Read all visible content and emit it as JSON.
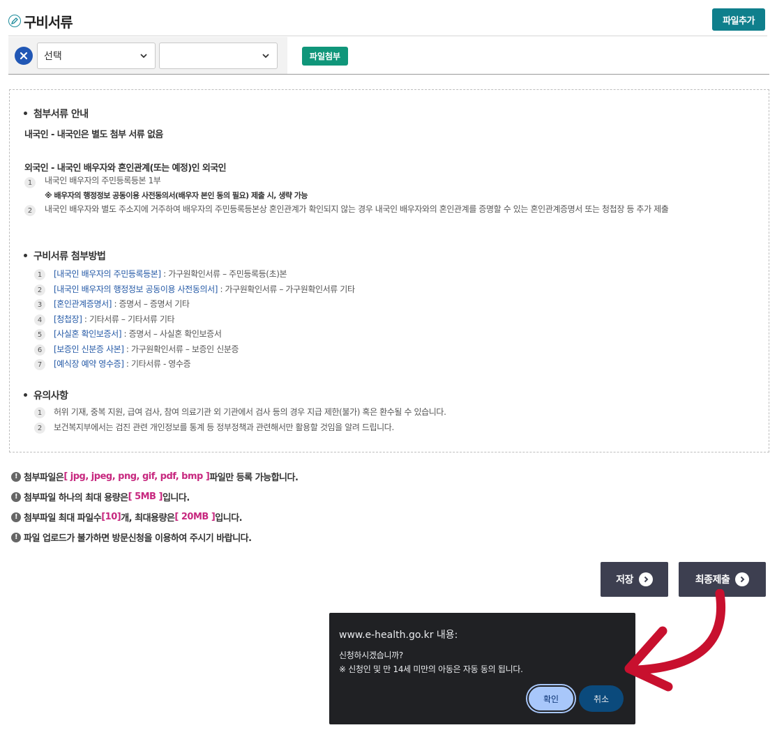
{
  "header": {
    "title": "구비서류",
    "add_file_label": "파일추가"
  },
  "file_row": {
    "select1_value": "선택",
    "select2_value": "",
    "attach_label": "파일첨부"
  },
  "info": {
    "guide": {
      "title": "첨부서류 안내",
      "domestic": "내국인 - 내국인은 별도 첨부 서류 없음",
      "foreign": "외국인 - 내국인 배우자와 혼인관계(또는 예정)인 외국인",
      "items": [
        {
          "num": "1",
          "text": "내국인 배우자의 주민등록등본 1부"
        },
        {
          "num": "2",
          "text": "내국인 배우자와 별도 주소지에 거주하여 배우자의 주민등록등본상 혼인관계가 확인되지 않는 경우 내국인 배우자와의 혼인관계를 증명할 수 있는 혼인관계증명서 또는 청첩장 등 추가 제출"
        }
      ],
      "note": "※ 배우자의 행정정보 공동이용 사전동의서(배우자 본인 동의 필요) 제출 시, 생략 가능"
    },
    "method": {
      "title": "구비서류 첨부방법",
      "items": [
        {
          "num": "1",
          "link": "[내국인 배우자의 주민등록등본]",
          "text": " : 가구원확인서류 – 주민등록등(초)본"
        },
        {
          "num": "2",
          "link": "[내국인 배우자의 행정정보 공동이용 사전동의서]",
          "text": " : 가구원확인서류 – 가구원확인서류 기타"
        },
        {
          "num": "3",
          "link": "[혼인관계증명서]",
          "text": " : 증명서 – 증명서 기타"
        },
        {
          "num": "4",
          "link": "[청첩장]",
          "text": " : 기타서류 – 기타서류 기타"
        },
        {
          "num": "5",
          "link": "[사실혼 확인보증서]",
          "text": " : 증명서 – 사실혼 확인보증서"
        },
        {
          "num": "6",
          "link": "[보증인 신분증 사본]",
          "text": " : 가구원확인서류 – 보증인 신분증"
        },
        {
          "num": "7",
          "link": "[예식장 예약 영수증]",
          "text": " : 기타서류 - 영수증"
        }
      ]
    },
    "caution": {
      "title": "유의사항",
      "items": [
        {
          "num": "1",
          "text": "허위 기재, 중복 지원, 급여 검사, 참여 의료기관 외 기관에서 검사 등의 경우 지급 제한(불가) 혹은 환수될 수 있습니다."
        },
        {
          "num": "2",
          "text": "보건복지부에서는 검진 관련 개인정보를 통계 등 정부정책과 관련해서만 활용할 것임을 알려 드립니다."
        }
      ]
    }
  },
  "notices": [
    {
      "pre": "첨부파일은 ",
      "hl": "[ jpg, jpeg, png, gif, pdf, bmp ]",
      "post": " 파일만 등록 가능합니다."
    },
    {
      "pre": "첨부파일 하나의 최대 용량은 ",
      "hl": "[ 5MB ]",
      "post": " 입니다."
    },
    {
      "pre": "첨부파일 최대 파일수 ",
      "hl": "[10]",
      "post": " 개, 최대용량은 ",
      "hl2": "[ 20MB ]",
      "post2": " 입니다."
    },
    {
      "pre": "파일 업로드가 불가하면 방문신청을 이용하여 주시기 바랍니다.",
      "hl": "",
      "post": ""
    }
  ],
  "actions": {
    "save_label": "저장",
    "submit_label": "최종제출"
  },
  "dialog": {
    "title": "www.e-health.go.kr 내용:",
    "line1": "신청하시겠습니까?",
    "line2": "※ 신청인 및 만 14세 미만의 아동은 자동 동의 됩니다.",
    "ok_label": "확인",
    "cancel_label": "취소"
  },
  "colors": {
    "accent_teal": "#0f7f8c",
    "attach_green": "#10967a",
    "link_blue": "#2459a6",
    "highlight_pink": "#c7287f",
    "annotation_red": "#c8102e"
  }
}
